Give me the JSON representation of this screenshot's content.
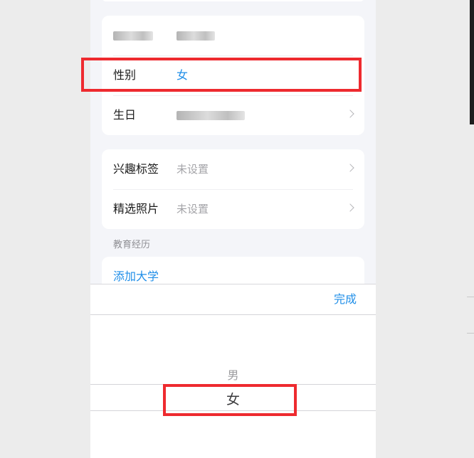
{
  "profile_card": {
    "gender_label": "性别",
    "gender_value": "女",
    "birthday_label": "生日"
  },
  "interests_card": {
    "interest_label": "兴趣标签",
    "interest_value": "未设置",
    "photos_label": "精选照片",
    "photos_value": "未设置"
  },
  "education": {
    "section_title": "教育经历",
    "add_label": "添加大学"
  },
  "picker": {
    "done_label": "完成",
    "options": [
      "男",
      "女"
    ],
    "selected": "女"
  },
  "colors": {
    "accent_blue": "#1f8ee8",
    "highlight_red": "#ee2a2f"
  }
}
